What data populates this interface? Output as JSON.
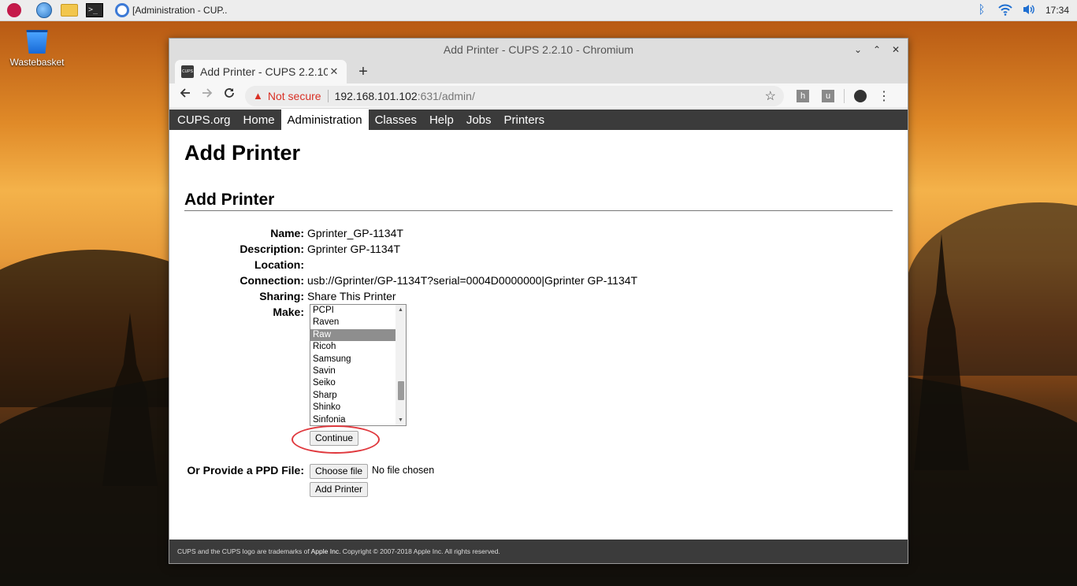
{
  "desktop": {
    "wastebasket_label": "Wastebasket"
  },
  "taskbar": {
    "task_label": "[Administration - CUP...",
    "clock": "17:34"
  },
  "browser": {
    "window_title": "Add Printer - CUPS 2.2.10 - Chromium",
    "tab_label": "Add Printer - CUPS 2.2.10",
    "tab_favicon_text": "CUPS",
    "security_label": "Not secure",
    "url_host": "192.168.101.102",
    "url_path": ":631/admin/",
    "ext1_letter": "h",
    "ext2_letter": "u"
  },
  "nav": {
    "items": [
      "CUPS.org",
      "Home",
      "Administration",
      "Classes",
      "Help",
      "Jobs",
      "Printers"
    ],
    "active": "Administration"
  },
  "page": {
    "title": "Add Printer",
    "section_title": "Add Printer",
    "fields": {
      "name_label": "Name:",
      "name_value": "Gprinter_GP-1134T",
      "description_label": "Description:",
      "description_value": "Gprinter GP-1134T",
      "location_label": "Location:",
      "location_value": "",
      "connection_label": "Connection:",
      "connection_value": "usb://Gprinter/GP-1134T?serial=0004D0000000|Gprinter GP-1134T",
      "sharing_label": "Sharing:",
      "sharing_value": "Share This Printer",
      "make_label": "Make:"
    },
    "make_options": [
      "PCPI",
      "Raven",
      "Raw",
      "Ricoh",
      "Samsung",
      "Savin",
      "Seiko",
      "Sharp",
      "Shinko",
      "Sinfonia"
    ],
    "make_selected": "Raw",
    "continue_label": "Continue",
    "ppd_label": "Or Provide a PPD File:",
    "choose_file_label": "Choose file",
    "no_file_text": "No file chosen",
    "add_printer_label": "Add Printer"
  },
  "footer": {
    "text_before": "CUPS and the CUPS logo are trademarks of ",
    "link": "Apple Inc.",
    "text_after": " Copyright © 2007-2018 Apple Inc. All rights reserved."
  },
  "colors": {
    "nav_bg": "#3b3b3b",
    "selected_option": "#8e8e8e",
    "warning_red": "#d93025",
    "highlight_oval": "#e0393e"
  }
}
